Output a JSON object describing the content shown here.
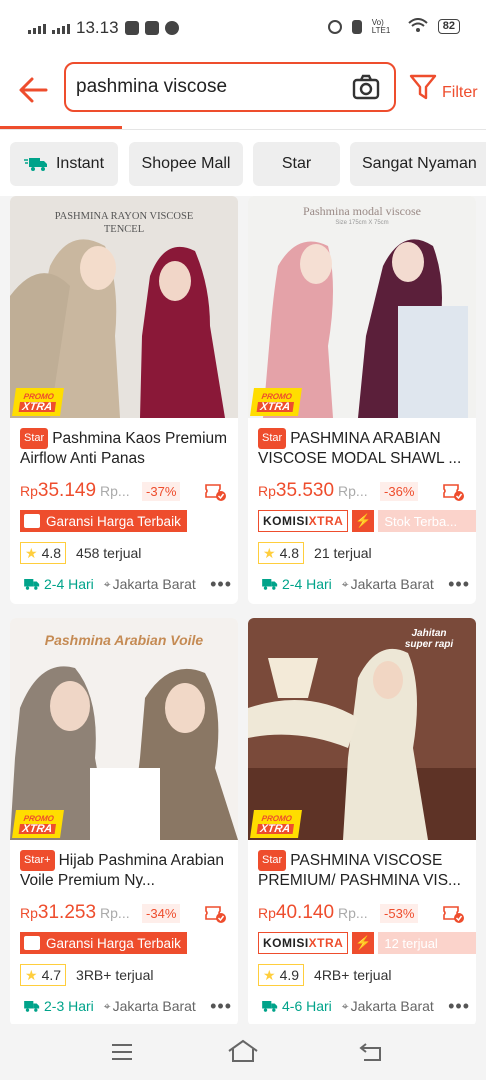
{
  "status": {
    "time": "13.13",
    "battery": "82",
    "network": "Vo) LTE1"
  },
  "search": {
    "query": "pashmina viscose",
    "filter_label": "Filter"
  },
  "chips": [
    {
      "label": "Instant"
    },
    {
      "label": "Shopee Mall"
    },
    {
      "label": "Star"
    },
    {
      "label": "Sangat Nyaman"
    }
  ],
  "products": [
    {
      "image_caption": "PASHMINA RAYON VISCOSE\nTENCEL",
      "promo_top": "PROMO",
      "promo_bottom": "XTRA",
      "badge": "Star",
      "title": "Pashmina Kaos Premium Airflow Anti Panas",
      "price": "35.149",
      "price_prefix": "Rp",
      "old_price": "Rp...",
      "discount": "-37%",
      "badge_type": "garansi",
      "badge1": "Garansi Harga Terbaik",
      "rating": "4.8",
      "sold": "458 terjual",
      "ship": "2-4 Hari",
      "location": "Jakarta Barat"
    },
    {
      "image_caption": "Pashmina modal viscose",
      "image_subcaption": "Size 175cm X 75cm",
      "promo_top": "PROMO",
      "promo_bottom": "XTRA",
      "badge": "Star",
      "title": "PASHMINA ARABIAN VISCOSE MODAL SHAWL ...",
      "price": "35.530",
      "price_prefix": "Rp",
      "old_price": "Rp...",
      "discount": "-36%",
      "badge_type": "komisi",
      "komisi_a": "KOMISI",
      "komisi_b": "XTRA",
      "badge2": "Stok Terba...",
      "rating": "4.8",
      "sold": "21 terjual",
      "ship": "2-4 Hari",
      "location": "Jakarta Barat"
    },
    {
      "image_caption": "Pashmina Arabian Voile",
      "promo_top": "PROMO",
      "promo_bottom": "XTRA",
      "badge": "Star+",
      "title": "Hijab Pashmina Arabian Voile Premium Ny...",
      "price": "31.253",
      "price_prefix": "Rp",
      "old_price": "Rp...",
      "discount": "-34%",
      "badge_type": "garansi",
      "badge1": "Garansi Harga Terbaik",
      "rating": "4.7",
      "sold": "3RB+ terjual",
      "ship": "2-3 Hari",
      "location": "Jakarta Barat"
    },
    {
      "image_caption": "Jahitan\nsuper rapi",
      "promo_top": "PROMO",
      "promo_bottom": "XTRA",
      "badge": "Star",
      "title": "PASHMINA VISCOSE PREMIUM/ PASHMINA VIS...",
      "price": "40.140",
      "price_prefix": "Rp",
      "old_price": "Rp...",
      "discount": "-53%",
      "badge_type": "komisi",
      "komisi_a": "KOMISI",
      "komisi_b": "XTRA",
      "badge2": "12 terjual",
      "rating": "4.9",
      "sold": "4RB+ terjual",
      "ship": "4-6 Hari",
      "location": "Jakarta Barat"
    }
  ],
  "colors": {
    "accent": "#ee4d2d",
    "ship": "#00a38a"
  }
}
